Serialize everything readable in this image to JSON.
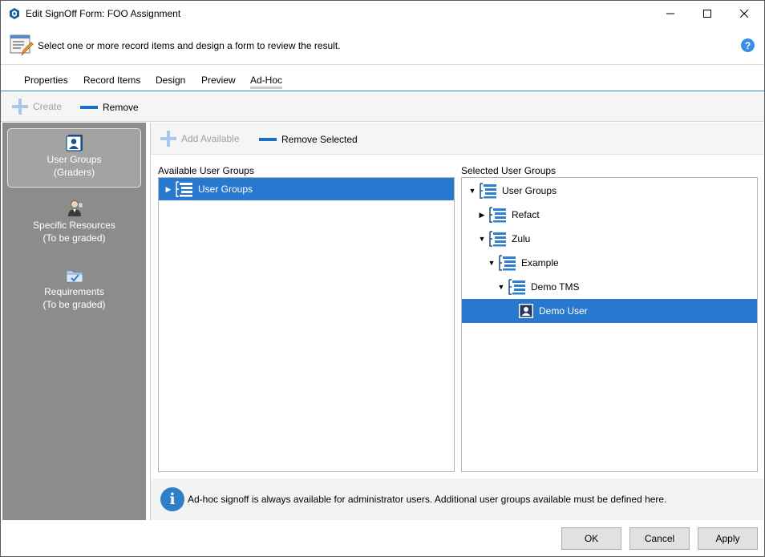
{
  "window": {
    "title": "Edit SignOff Form: FOO Assignment"
  },
  "header": {
    "instruction": "Select one or more record items and design a form to review the result."
  },
  "tabs": [
    {
      "label": "Properties"
    },
    {
      "label": "Record Items"
    },
    {
      "label": "Design"
    },
    {
      "label": "Preview"
    },
    {
      "label": "Ad-Hoc",
      "active": true
    }
  ],
  "toolbar": {
    "create_label": "Create",
    "remove_label": "Remove"
  },
  "leftnav": [
    {
      "line1": "User Groups",
      "line2": "(Graders)",
      "icon": "user-badge-icon",
      "selected": true
    },
    {
      "line1": "Specific Resources",
      "line2": "(To be graded)",
      "icon": "person-icon"
    },
    {
      "line1": "Requirements",
      "line2": "(To be graded)",
      "icon": "folder-check-icon"
    }
  ],
  "content": {
    "add_available_label": "Add Available",
    "remove_selected_label": "Remove Selected",
    "available_title": "Available User Groups",
    "selected_title": "Selected User Groups",
    "available_tree": [
      {
        "label": "User Groups",
        "expanded": false,
        "selected": true
      }
    ],
    "selected_tree": [
      {
        "label": "User Groups",
        "depth": 0,
        "expanded": true
      },
      {
        "label": "Refact",
        "depth": 1,
        "expanded": false
      },
      {
        "label": "Zulu",
        "depth": 1,
        "expanded": true
      },
      {
        "label": "Example",
        "depth": 2,
        "expanded": true
      },
      {
        "label": "Demo TMS",
        "depth": 3,
        "expanded": true
      },
      {
        "label": "Demo User",
        "depth": 4,
        "type": "user",
        "selected": true
      }
    ],
    "info_text": "Ad-hoc signoff is always available for administrator users. Additional user groups available must be defined here."
  },
  "footer": {
    "ok_label": "OK",
    "cancel_label": "Cancel",
    "apply_label": "Apply"
  },
  "colors": {
    "accent": "#2978cf",
    "nav_bg": "#8c8c8a",
    "remove_bar": "#1a6fc4"
  }
}
